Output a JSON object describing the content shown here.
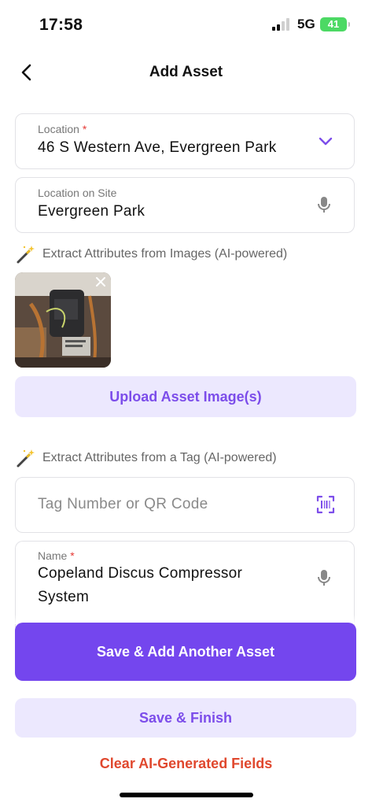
{
  "status_bar": {
    "time": "17:58",
    "network": "5G",
    "battery": "41"
  },
  "header": {
    "title": "Add Asset"
  },
  "location": {
    "label": "Location",
    "required": "*",
    "value": "46 S Western Ave, Evergreen Park"
  },
  "location_on_site": {
    "label": "Location on Site",
    "value": "Evergreen Park"
  },
  "image_extract_hint": "Extract Attributes from Images (AI-powered)",
  "upload_button": "Upload Asset Image(s)",
  "tag_extract_hint": "Extract Attributes from a Tag (AI-powered)",
  "tag_field": {
    "placeholder": "Tag Number or QR Code"
  },
  "name_field": {
    "label": "Name",
    "required": "*",
    "value_line1": "Copeland Discus Compressor",
    "value_line2": "System"
  },
  "actions": {
    "save_add_another": "Save & Add Another Asset",
    "save_finish": "Save & Finish",
    "clear_ai": "Clear AI-Generated Fields"
  },
  "colors": {
    "accent": "#7446ee",
    "accent_light": "#ece8fe",
    "danger": "#e0482e",
    "battery": "#4cd964"
  },
  "icons": [
    "back-chevron-icon",
    "chevron-down-icon",
    "microphone-icon",
    "magic-wand-icon",
    "close-icon",
    "qr-scan-icon"
  ]
}
